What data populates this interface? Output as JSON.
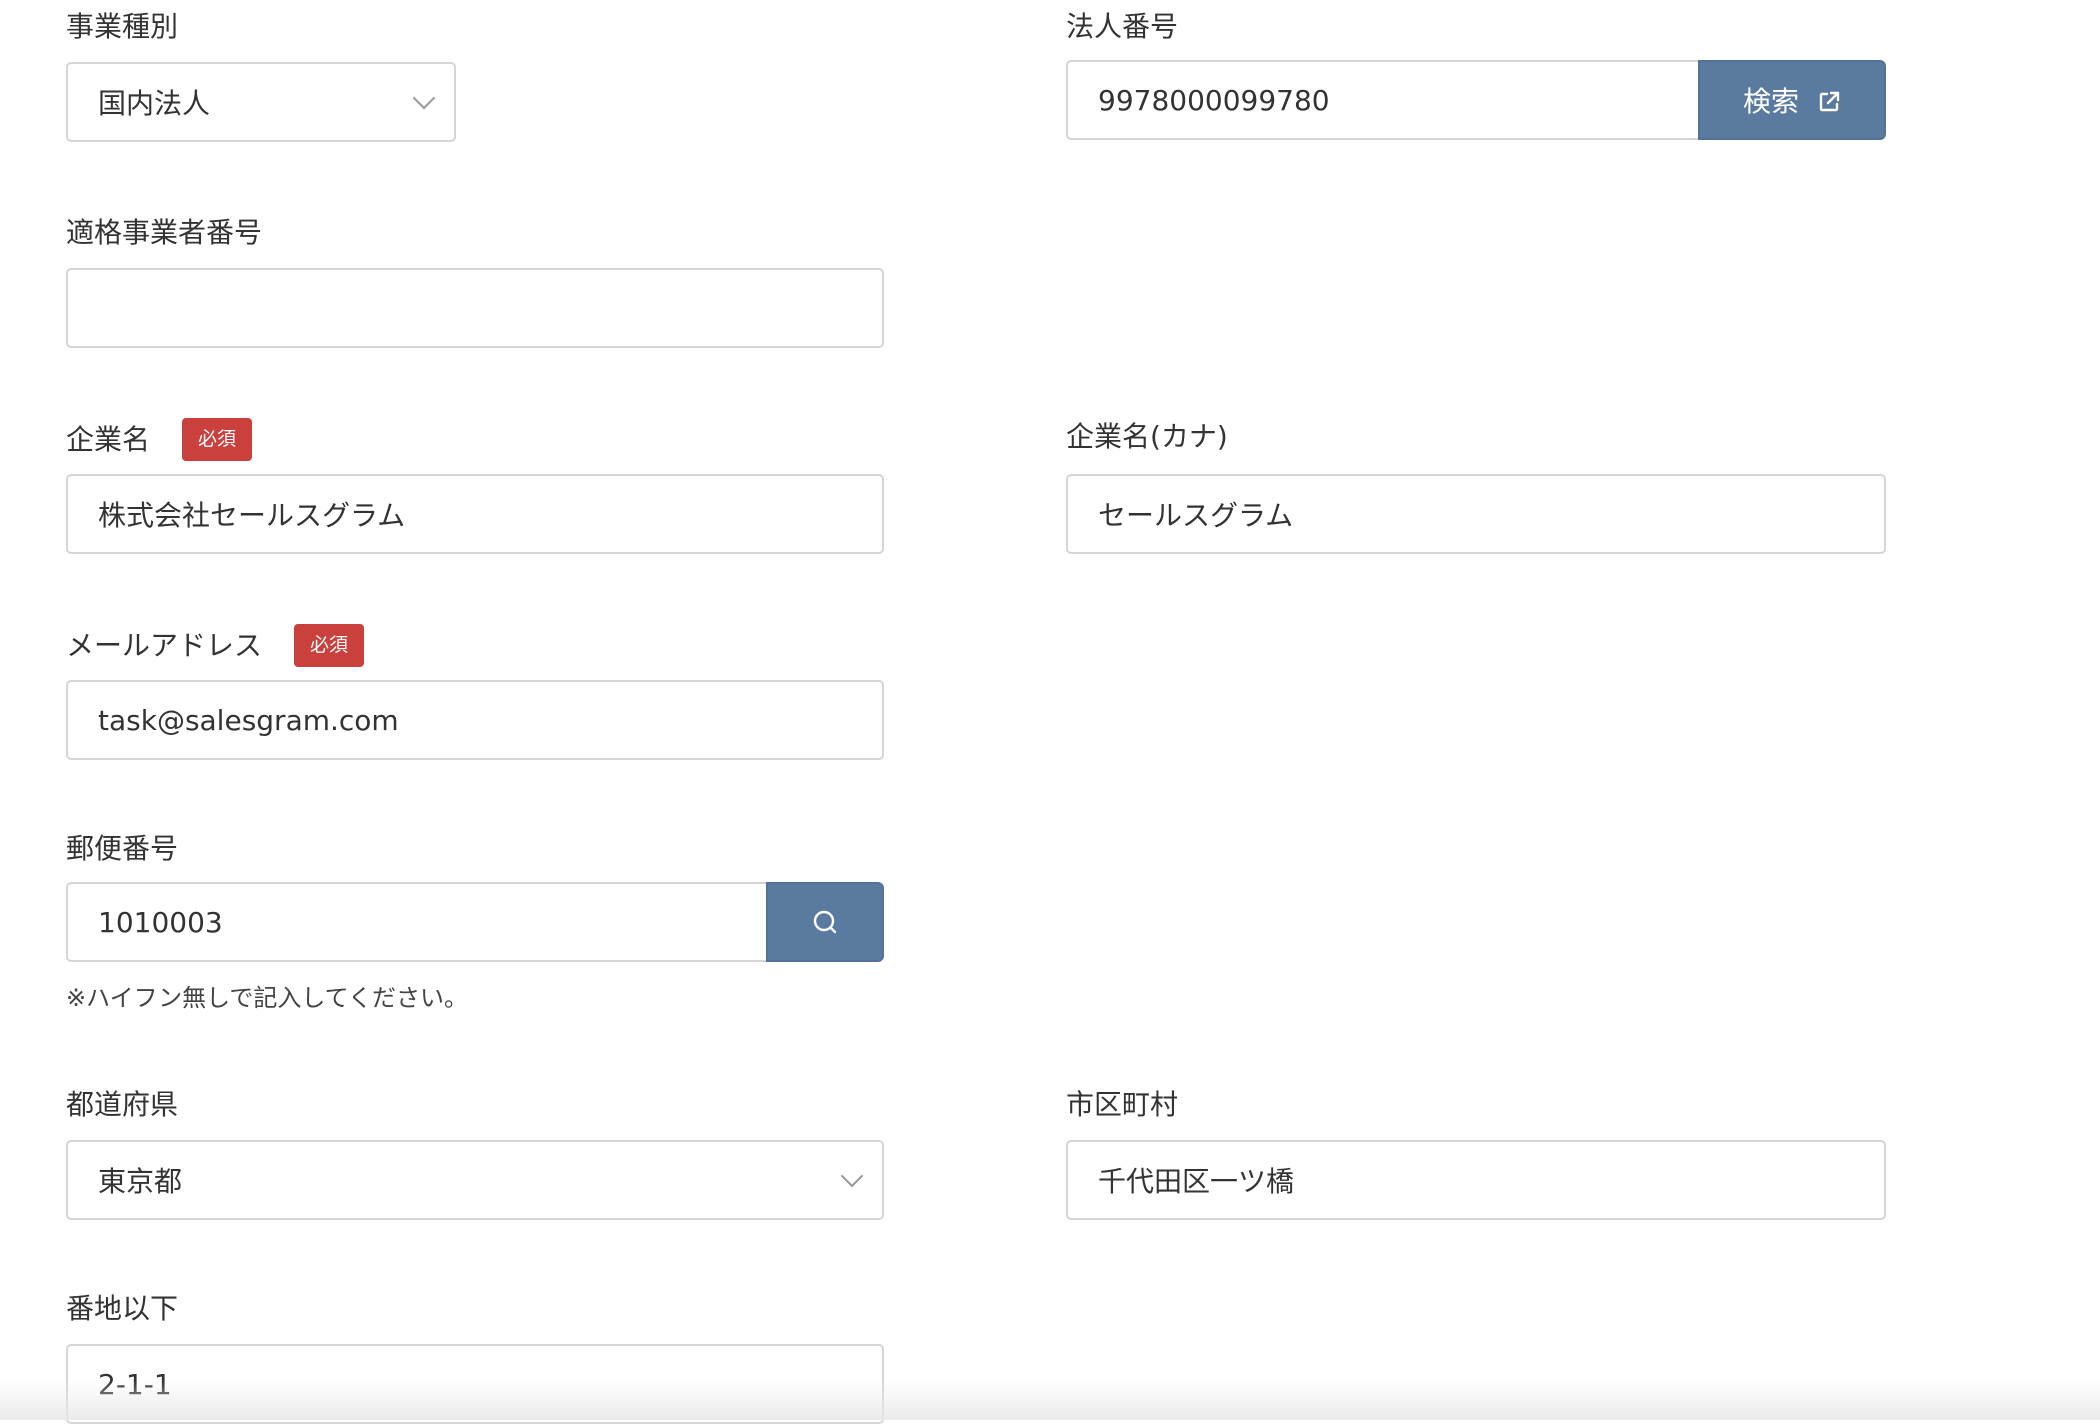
{
  "business_type": {
    "label": "事業種別",
    "value": "国内法人"
  },
  "corporate_number": {
    "label": "法人番号",
    "value": "9978000099780",
    "search_label": "検索"
  },
  "invoice_number": {
    "label": "適格事業者番号",
    "value": ""
  },
  "company_name": {
    "label": "企業名",
    "required_badge": "必須",
    "value": "株式会社セールスグラム"
  },
  "company_name_kana": {
    "label": "企業名(カナ)",
    "value": "セールスグラム"
  },
  "email": {
    "label": "メールアドレス",
    "required_badge": "必須",
    "value": "task@salesgram.com"
  },
  "postal_code": {
    "label": "郵便番号",
    "value": "1010003",
    "hint": "※ハイフン無しで記入してください。"
  },
  "prefecture": {
    "label": "都道府県",
    "value": "東京都"
  },
  "city": {
    "label": "市区町村",
    "value": "千代田区一ツ橋"
  },
  "street": {
    "label": "番地以下",
    "value": "2-1-1"
  },
  "colors": {
    "button": "#5a7aa0",
    "required_badge": "#c9403d",
    "border": "#d5d5d5"
  },
  "icons": {
    "corp_search": "external-link-icon",
    "zip_search": "search-icon",
    "select": "chevron-down-icon"
  }
}
